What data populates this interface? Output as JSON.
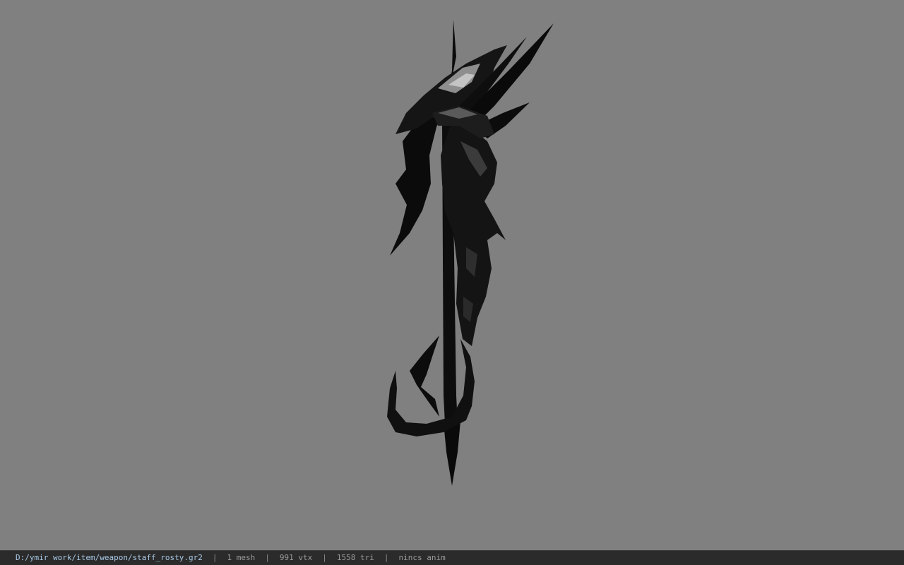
{
  "viewer": {
    "background_color": "#808080",
    "model_shape": "dark-staff-with-spikes"
  },
  "status_bar": {
    "file_path": "D:/ymir work/item/weapon/staff_rosty.gr2",
    "separator": "|",
    "mesh_count": "1 mesh",
    "vertex_count": "991 vtx",
    "triangle_count": "1558 tri",
    "animation": "nincs anim"
  }
}
